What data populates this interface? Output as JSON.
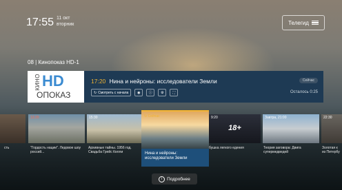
{
  "clock": {
    "time": "17:55",
    "date_line1": "11 окт",
    "date_line2": "вторник"
  },
  "header": {
    "tvguide_label": "Телегид"
  },
  "channel": {
    "title": "08 | Кинопоказ HD-1"
  },
  "logo": {
    "kino": "КИНО",
    "hd_h": "H",
    "hd_d": "D",
    "pokaz": "ОПОКАЗ"
  },
  "now_playing": {
    "time": "17:20",
    "title": "Нина и нейроны: исследователи Земли",
    "badge": "Сейчас",
    "remaining": "Осталось 0:25",
    "watch_from_start": "Смотреть с начала"
  },
  "schedule": [
    {
      "tag": "",
      "caption": "сть"
    },
    {
      "tag": "13:20",
      "tag_red": true,
      "caption": "\"Гордость нации\". Ледовое шоу россий..."
    },
    {
      "tag": "15:30",
      "tag_red": false,
      "caption": "Архивные тайны. 1956 год. Свадьба Грейс Келли"
    },
    {
      "tag": "Сейчас",
      "tag_red": false,
      "caption": "Нина и нейроны: исследователи Земли"
    },
    {
      "tag": "9:20",
      "tag_red": false,
      "caption": "бушка легкого едения",
      "age": "18+"
    },
    {
      "tag": "Завтра, 21:00",
      "tag_red": false,
      "caption": "Теория заговора: Двига супермедведей"
    },
    {
      "tag": "22:30",
      "tag_red": false,
      "caption": "Золотая к из Петербу"
    }
  ],
  "more_label": "Подробнее",
  "colors": {
    "accent": "#f2b433",
    "panel": "#1e3a54",
    "active_info": "#1e4f7a"
  }
}
